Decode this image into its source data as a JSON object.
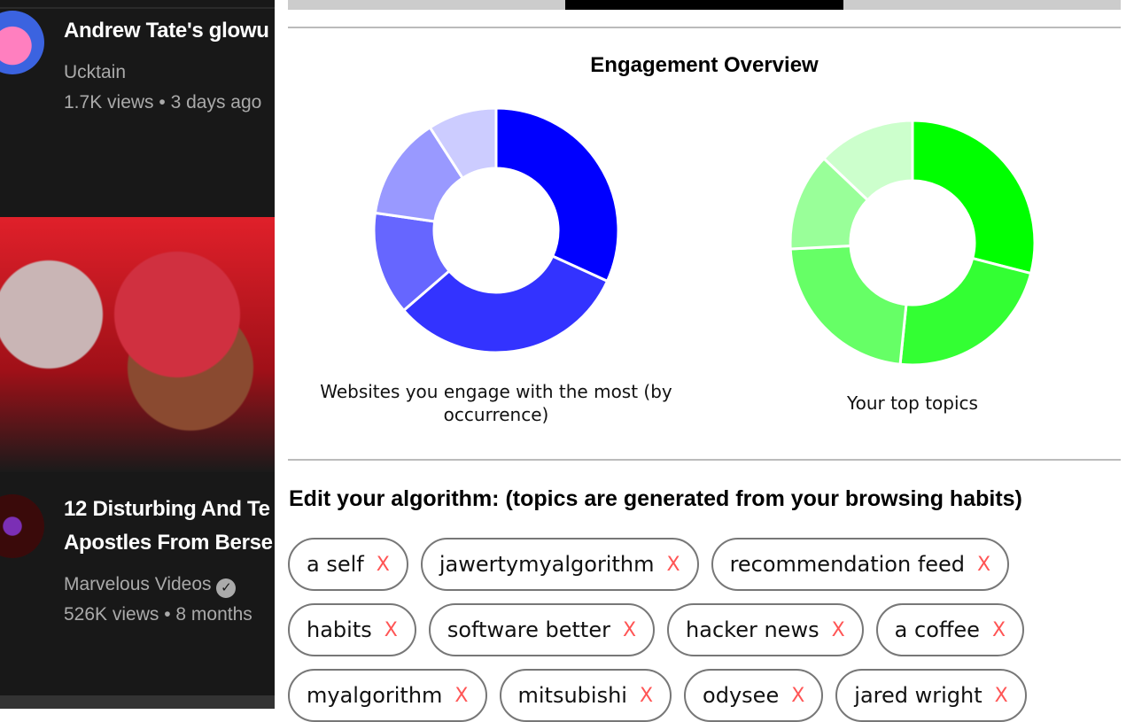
{
  "youtube": {
    "videos": [
      {
        "title": "Andrew Tate's glowu",
        "channel": "Ucktain",
        "meta": "1.7K views • 3 days ago"
      },
      {
        "title_line1": "12 Disturbing And Te",
        "title_line2": "Apostles From Berse",
        "channel": "Marvelous Videos",
        "verified": true,
        "meta": "526K views • 8 months"
      }
    ]
  },
  "panel": {
    "tabs_active_index": 1,
    "heading": "Engagement Overview",
    "edit_heading": "Edit your algorithm: (topics are generated from your browsing habits)",
    "remove_label": "X",
    "tags": [
      "a self",
      "jawertymyalgorithm",
      "recommendation feed",
      "habits",
      "software better",
      "hacker news",
      "a coffee",
      "myalgorithm",
      "mitsubishi",
      "odysee",
      "jared wright"
    ]
  },
  "chart_data": [
    {
      "type": "pie",
      "donut": true,
      "title": "Websites you engage with the most (by occurrence)",
      "values": [
        7,
        7,
        3,
        3,
        2
      ],
      "colors": [
        "#0000ff",
        "#3333ff",
        "#6666ff",
        "#9999ff",
        "#ccccff"
      ]
    },
    {
      "type": "pie",
      "donut": true,
      "title": "Your top topics",
      "values": [
        9,
        7,
        7,
        4,
        4
      ],
      "colors": [
        "#00ff00",
        "#33ff33",
        "#66ff66",
        "#99ff99",
        "#ccffcc"
      ]
    }
  ]
}
